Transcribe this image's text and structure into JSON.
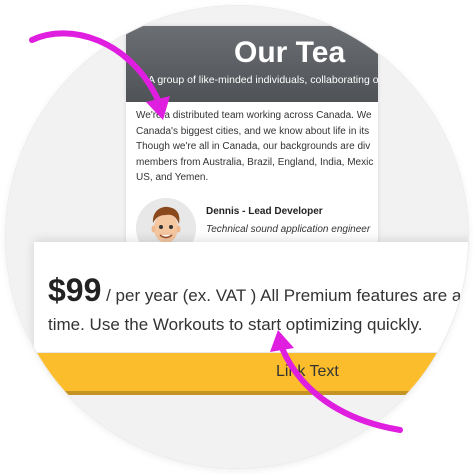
{
  "webpage": {
    "title": "Our Tea",
    "subtitle": "A group of like-minded individuals, collaborating o",
    "body_lines": [
      "We're a distributed team working across Canada. We",
      "Canada's biggest cities, and we know about life in its",
      "Though we're all in Canada, our backgrounds are div",
      "members from Australia, Brazil, England, India, Mexic",
      "US, and Yemen."
    ],
    "member": {
      "name": "Dennis - Lead Developer",
      "description": "Technical sound application engineer",
      "description_faded": "..."
    }
  },
  "pricing": {
    "amount": "$99",
    "line1_rest": " / per year (ex. VAT ) All Premium features are aimed",
    "line2": "time. Use the Workouts to start optimizing quickly."
  },
  "cta": {
    "label": "Link Text"
  },
  "colors": {
    "arrow": "#e01ee0",
    "cta": "#fbbd2b",
    "header": "#5c5f63"
  }
}
